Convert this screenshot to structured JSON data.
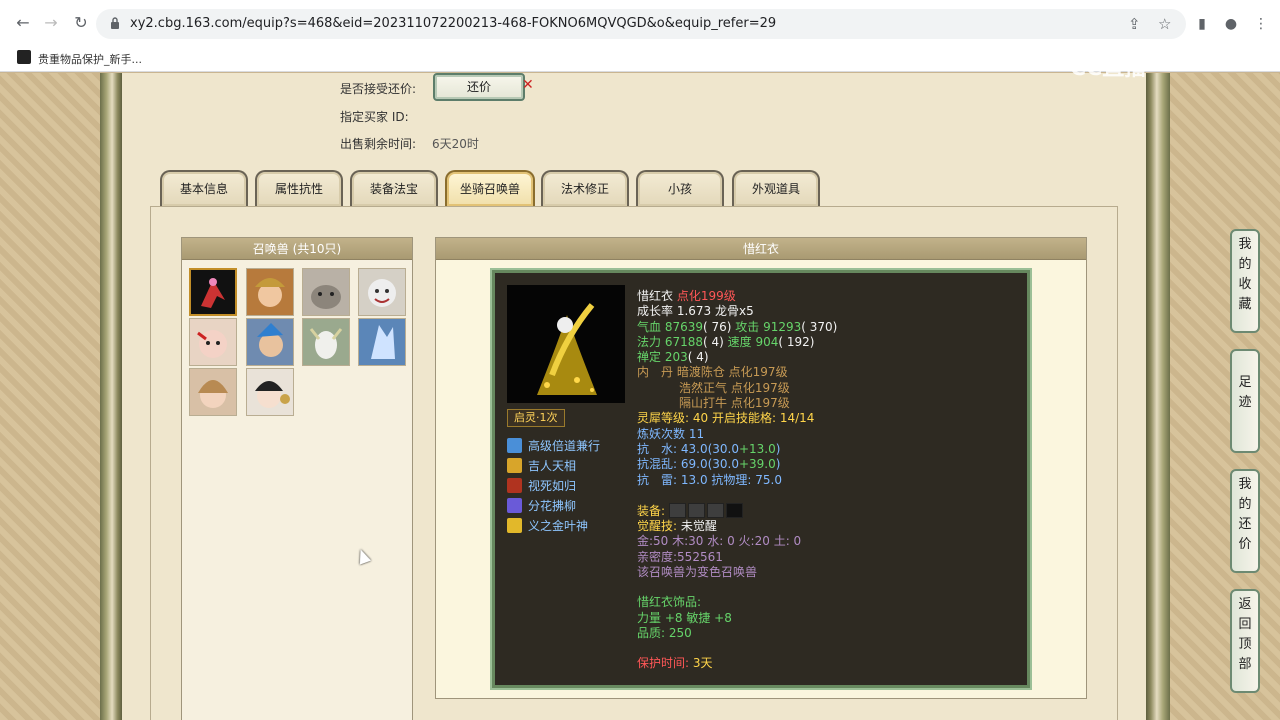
{
  "browser": {
    "url": "xy2.cbg.163.com/equip?s=468&eid=202311072200213-468-FOKNO6MQVQGD&o&equip_refer=29",
    "bookmark_label": "贵重物品保护_新手..."
  },
  "offer": {
    "accept_label": "是否接受还价:",
    "offer_button": "还价",
    "buyer_label": "指定买家 ID:",
    "remaining_label": "出售剩余时间:",
    "remaining_value": "6天20时"
  },
  "tabs": [
    "基本信息",
    "属性抗性",
    "装备法宝",
    "坐骑召唤兽",
    "法术修正",
    "小孩",
    "外观道具"
  ],
  "active_tab": "坐骑召唤兽",
  "pets": {
    "header": "召唤兽 (共10只)"
  },
  "detail": {
    "header": "惜红衣",
    "awaken_badge": "启灵·1次",
    "skills": [
      "高级倍道兼行",
      "吉人天相",
      "视死如归",
      "分花拂柳",
      "义之金叶神"
    ],
    "name": "惜红衣",
    "name_note": "点化199级",
    "growth": "成长率 1.673 龙骨x5",
    "hp_line_a": "气血 87639",
    "hp_line_b": "( 76) ",
    "atk_a": "攻击 91293",
    "atk_b": "( 370)",
    "mp_a": "法力 67188",
    "mp_b": "( 4) ",
    "spd_a": "速度 904",
    "spd_b": "( 192)",
    "chan_a": "禅定 203",
    "chan_b": "( 4)",
    "neidan_label": "内　丹",
    "neidan_1": "暗渡陈仓 点化197级",
    "neidan_2": "浩然正气 点化197级",
    "neidan_3": "隔山打牛 点化197级",
    "lingxi_label": "灵犀等级:",
    "lingxi_value": "40 开启技能格:",
    "lingxi_slots": "14/14",
    "lianyao": "炼妖次数 11",
    "kang_shui_a": "抗　水: 43.0(30.0",
    "kang_shui_b": "+13.0",
    "kang_shui_c": ")",
    "kang_hun_a": "抗混乱: 69.0(30.0",
    "kang_hun_b": "+39.0",
    "kang_hun_c": ")",
    "kang_lei": "抗　雷: 13.0 抗物理: 75.0",
    "equip_label": "装备:",
    "juexing_label": "觉醒技:",
    "juexing_value": "未觉醒",
    "wuxing": "金:50 木:30 水: 0 火:20 土: 0",
    "qinmi": "亲密度:552561",
    "bianse": "该召唤兽为变色召唤兽",
    "ornament_label": "惜红衣饰品:",
    "ornament_stats": "力量 +8 敏捷 +8",
    "ornament_quality": "品质:  250",
    "protect_label": "保护时间:",
    "protect_value": "3天"
  },
  "float_buttons": [
    "我的收藏",
    "足迹",
    "我的还价",
    "返回顶部"
  ],
  "watermark": "CC直播"
}
